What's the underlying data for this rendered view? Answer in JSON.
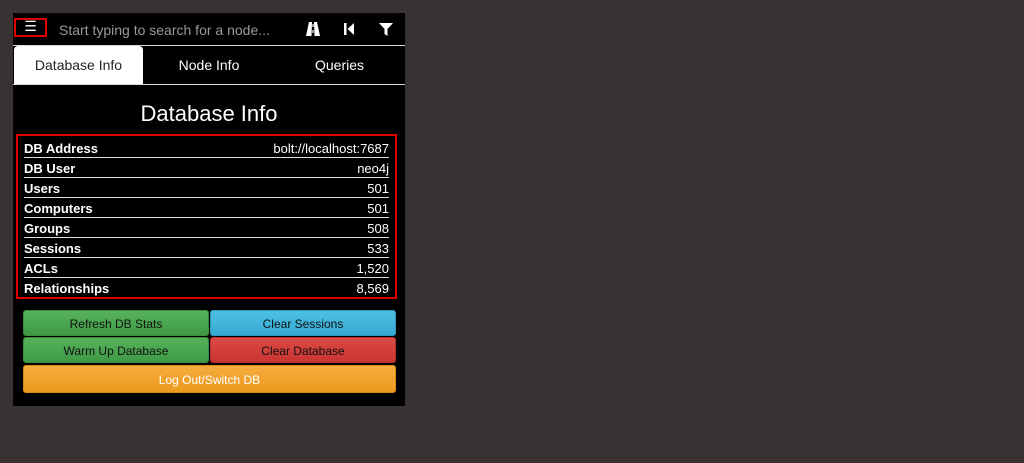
{
  "search": {
    "menu_icon": "hamburger-icon",
    "placeholder": "Start typing to search for a node..."
  },
  "toolbar": {
    "icons": [
      "path-finding-icon",
      "back-icon",
      "filter-icon"
    ]
  },
  "tabs": [
    {
      "label": "Database Info",
      "active": true
    },
    {
      "label": "Node Info",
      "active": false
    },
    {
      "label": "Queries",
      "active": false
    }
  ],
  "db_info": {
    "title": "Database Info",
    "rows": [
      {
        "key": "DB Address",
        "value": "bolt://localhost:7687"
      },
      {
        "key": "DB User",
        "value": "neo4j"
      },
      {
        "key": "Users",
        "value": "501"
      },
      {
        "key": "Computers",
        "value": "501"
      },
      {
        "key": "Groups",
        "value": "508"
      },
      {
        "key": "Sessions",
        "value": "533"
      },
      {
        "key": "ACLs",
        "value": "1,520"
      },
      {
        "key": "Relationships",
        "value": "8,569"
      }
    ]
  },
  "buttons": {
    "refresh": "Refresh DB Stats",
    "clear_sessions": "Clear Sessions",
    "warm_up": "Warm Up Database",
    "clear_db": "Clear Database",
    "logout": "Log Out/Switch DB"
  },
  "colors": {
    "background": "#383332",
    "panel": "#000000",
    "highlight_border": "#e00000",
    "green": "#4cae4c",
    "blue": "#3db3da",
    "red": "#d43f3a",
    "orange": "#f0a22a"
  }
}
